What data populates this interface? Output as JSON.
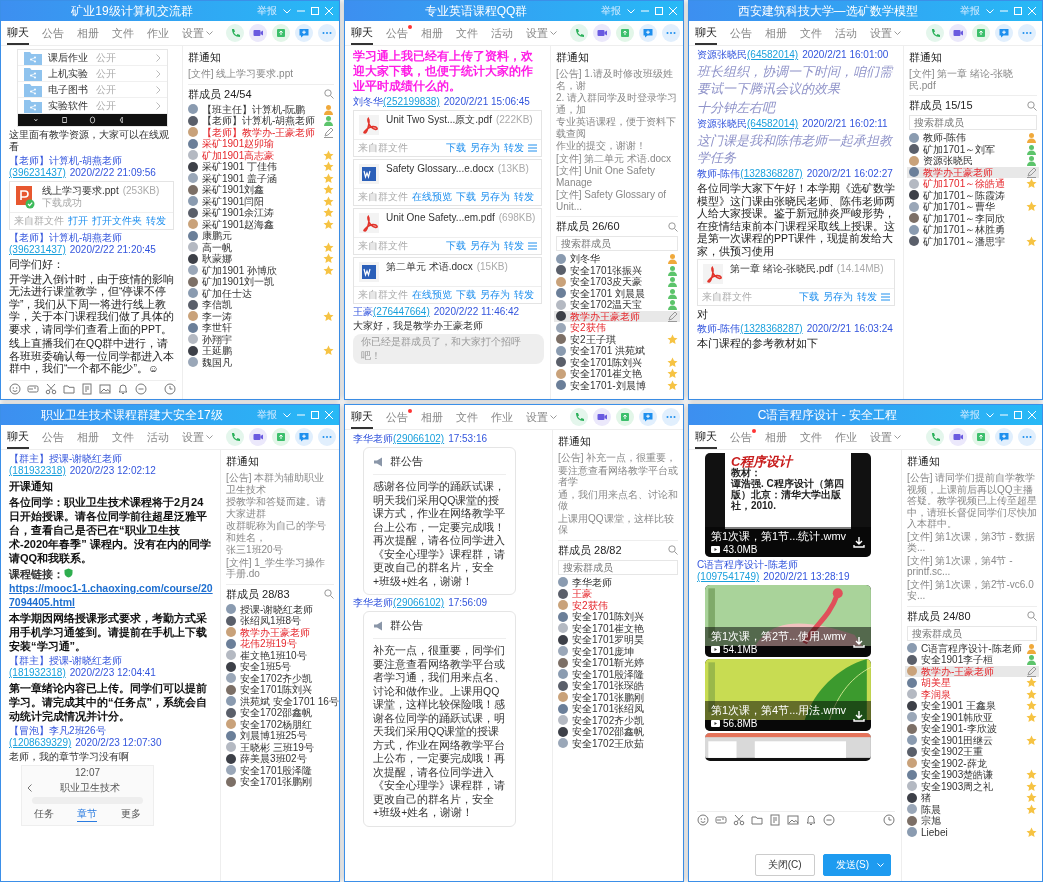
{
  "windows": [
    {
      "title": "矿业19级计算机交流群",
      "report_label": "举报",
      "tabs": [
        {
          "label": "聊天",
          "selected": true,
          "dot": false,
          "menu": false
        },
        {
          "label": "公告",
          "selected": false,
          "dot": false,
          "menu": false
        },
        {
          "label": "相册",
          "selected": false,
          "dot": false,
          "menu": false
        },
        {
          "label": "文件",
          "selected": false,
          "dot": false,
          "menu": false
        },
        {
          "label": "作业",
          "selected": false,
          "dot": false,
          "menu": false
        },
        {
          "label": "设置",
          "selected": false,
          "dot": false,
          "menu": true
        }
      ],
      "messages": [
        {
          "kind": "phone-folders",
          "folders": [
            {
              "name": "课后作业",
              "access": "公开"
            },
            {
              "name": "上机实验",
              "access": "公开"
            },
            {
              "name": "电子图书",
              "access": "公开"
            },
            {
              "name": "实验软件",
              "access": "公开"
            }
          ]
        },
        {
          "kind": "small",
          "text": "这里面有教学资源，大家可以在线观看"
        },
        {
          "kind": "sender",
          "name": "【老师】计算机-胡燕老师",
          "qq": "(396231437)",
          "time": "2020/2/22 21:09:56"
        },
        {
          "kind": "ppt",
          "name": "线上学习要求.ppt",
          "size": "(253KB)",
          "status": "下载成功",
          "source": "来自群文件",
          "actions": [
            "打开",
            "打开文件夹",
            "转发"
          ]
        },
        {
          "kind": "sender",
          "name": "【老师】计算机-胡燕老师",
          "qq": "(396231437)",
          "time": "2020/2/22 21:20:45"
        },
        {
          "kind": "text",
          "text": "同学们好："
        },
        {
          "kind": "text",
          "text": "开学进入倒计时，由于疫情的影响无法进行课堂教学，但“停课不停学”，我们从下周一将进行线上教学，关于本门课程我们做了具体的要求，请同学们查看上面的PPT。"
        },
        {
          "kind": "text",
          "text": "线上直播我们在QQ群中进行，请各班班委确认每一位同学都进入本群中，我们“一个都不能少”。☺"
        }
      ],
      "input_toolbar": true,
      "notice_title": "群通知",
      "notices": [
        "[文件] 线上学习要求.ppt"
      ],
      "members_title": "群成员 24/54",
      "members": [
        {
          "name": "【班主任】计算机-阮鹏",
          "highlighted": false,
          "kind": "owner",
          "selected": false
        },
        {
          "name": "【老师】计算机-胡燕老师",
          "highlighted": false,
          "kind": "manager",
          "selected": false
        },
        {
          "name": "【老师】教学办-王豪老师",
          "highlighted": true,
          "kind": "self",
          "selected": false
        },
        {
          "name": "采矿1901赵卯瑜",
          "highlighted": true,
          "kind": "plain",
          "selected": false
        },
        {
          "name": "矿加1901高志豪",
          "highlighted": true,
          "kind": "star",
          "selected": false
        },
        {
          "name": "采矿1901 丁佳伟",
          "highlighted": false,
          "kind": "star",
          "selected": false
        },
        {
          "name": "采矿1901 盖子涵",
          "highlighted": false,
          "kind": "star",
          "selected": false
        },
        {
          "name": "采矿1901刘鑫",
          "highlighted": false,
          "kind": "star",
          "selected": false
        },
        {
          "name": "采矿1901闫阳",
          "highlighted": false,
          "kind": "star",
          "selected": false
        },
        {
          "name": "采矿1901余江涛",
          "highlighted": false,
          "kind": "star",
          "selected": false
        },
        {
          "name": "采矿1901赵海鑫",
          "highlighted": false,
          "kind": "star",
          "selected": false
        },
        {
          "name": "康鹏元",
          "highlighted": false,
          "kind": "plain",
          "selected": false
        },
        {
          "name": "高一帆",
          "highlighted": false,
          "kind": "star",
          "selected": false
        },
        {
          "name": "耿蒙娜",
          "highlighted": false,
          "kind": "star",
          "selected": false
        },
        {
          "name": "矿加1901 孙博欣",
          "highlighted": false,
          "kind": "star",
          "selected": false
        },
        {
          "name": "矿加1901刘一凯",
          "highlighted": false,
          "kind": "plain",
          "selected": false
        },
        {
          "name": "矿加任士达",
          "highlighted": false,
          "kind": "plain",
          "selected": false
        },
        {
          "name": "李信凯",
          "highlighted": false,
          "kind": "plain",
          "selected": false
        },
        {
          "name": "李一涛",
          "highlighted": false,
          "kind": "star",
          "selected": false
        },
        {
          "name": "李世轩",
          "highlighted": false,
          "kind": "plain",
          "selected": false
        },
        {
          "name": "孙翔宇",
          "highlighted": false,
          "kind": "plain",
          "selected": false
        },
        {
          "name": "王延鹏",
          "highlighted": false,
          "kind": "star",
          "selected": false
        },
        {
          "name": "魏国凡",
          "highlighted": false,
          "kind": "plain",
          "selected": false
        }
      ]
    },
    {
      "title": "专业英语课程QQ群",
      "report_label": "举报",
      "tabs": [
        {
          "label": "聊天",
          "selected": true,
          "dot": false,
          "menu": false
        },
        {
          "label": "公告",
          "selected": false,
          "dot": true,
          "menu": false
        },
        {
          "label": "相册",
          "selected": false,
          "dot": false,
          "menu": false
        },
        {
          "label": "文件",
          "selected": false,
          "dot": false,
          "menu": false
        },
        {
          "label": "活动",
          "selected": false,
          "dot": false,
          "menu": false
        },
        {
          "label": "设置",
          "selected": false,
          "dot": false,
          "menu": true
        }
      ],
      "messages": [
        {
          "kind": "highlight",
          "text": "学习通上我已经有上传了资料，欢迎大家下载，也便于统计大家的作业平时成绩什么的。"
        },
        {
          "kind": "sender",
          "name": "刘冬华",
          "qq": "(252199838)",
          "time": "2020/2/21 15:06:45"
        },
        {
          "kind": "pdf",
          "name": "Unit Two  Syst...原文.pdf",
          "size": "(222KB)",
          "source": "来自群文件",
          "actions": [
            "下载",
            "另存为",
            "转发"
          ]
        },
        {
          "kind": "word",
          "name": "Safety Glossary...e.docx",
          "size": "(13KB)",
          "source": "来自群文件",
          "actions": [
            "在线预览",
            "下载",
            "另存为",
            "转发"
          ]
        },
        {
          "kind": "pdf",
          "name": "Unit One Safety...em.pdf",
          "size": "(698KB)",
          "source": "来自群文件",
          "actions": [
            "下载",
            "另存为",
            "转发"
          ]
        },
        {
          "kind": "word",
          "name": "第二单元 术语.docx",
          "size": "(15KB)",
          "source": "来自群文件",
          "actions": [
            "在线预览",
            "下载",
            "另存为",
            "转发"
          ]
        },
        {
          "kind": "sender",
          "name": "王豪",
          "qq": "(276447664)",
          "time": "2020/2/22 11:46:42"
        },
        {
          "kind": "small",
          "text": "大家好，我是教学办王豪老师"
        },
        {
          "kind": "tip",
          "text": "你已经是群成员了，和大家打个招呼吧！"
        }
      ],
      "notice_title": "群通知",
      "notices": [
        "[公告] 1.请及时修改班级姓名，谢",
        "2. 请入群同学及时登录学习通，加",
        "专业英语课程，便于资料下载查阅",
        "作业的提交，谢谢！",
        "[文件] 第二单元 术语.docx",
        "[文件] Unit One Safety Manage",
        "[文件] Safety Glossary of Unit..."
      ],
      "members_title": "群成员 26/60",
      "search": {
        "placeholder": "搜索群成员"
      },
      "members": [
        {
          "name": "刘冬华",
          "highlighted": false,
          "kind": "owner",
          "selected": false
        },
        {
          "name": "安全1701张振兴",
          "highlighted": false,
          "kind": "manager",
          "selected": false
        },
        {
          "name": "安全1703皮天豪",
          "highlighted": false,
          "kind": "manager",
          "selected": false
        },
        {
          "name": "安全1701 刘晨晨",
          "highlighted": false,
          "kind": "manager",
          "selected": false
        },
        {
          "name": "安全1702温天宝",
          "highlighted": false,
          "kind": "manager",
          "selected": false
        },
        {
          "name": "教学办王豪老师",
          "highlighted": true,
          "kind": "self",
          "selected": true
        },
        {
          "name": "安2获伟",
          "highlighted": true,
          "kind": "plain",
          "selected": false
        },
        {
          "name": "安2王子琪",
          "highlighted": false,
          "kind": "star",
          "selected": false
        },
        {
          "name": "安全1701 洪苑斌",
          "highlighted": false,
          "kind": "plain",
          "selected": false
        },
        {
          "name": "安全1701陈刘兴",
          "highlighted": false,
          "kind": "star",
          "selected": false
        },
        {
          "name": "安全1701崔文艳",
          "highlighted": false,
          "kind": "star",
          "selected": false
        },
        {
          "name": "安全1701-刘晨博",
          "highlighted": false,
          "kind": "star",
          "selected": false
        }
      ]
    },
    {
      "title": "西安建筑科技大学—选矿数学模型",
      "report_label": "举报",
      "tabs": [
        {
          "label": "聊天",
          "selected": true,
          "dot": false,
          "menu": false
        },
        {
          "label": "公告",
          "selected": false,
          "dot": false,
          "menu": false
        },
        {
          "label": "相册",
          "selected": false,
          "dot": false,
          "menu": false
        },
        {
          "label": "文件",
          "selected": false,
          "dot": false,
          "menu": false
        },
        {
          "label": "活动",
          "selected": false,
          "dot": false,
          "menu": false
        },
        {
          "label": "设置",
          "selected": false,
          "dot": false,
          "menu": true
        }
      ],
      "messages": [
        {
          "kind": "sender",
          "name": "资源张晓民",
          "qq": "(64582014)",
          "time": "2020/2/21 16:01:00"
        },
        {
          "kind": "italic",
          "text": "班长组织，协调一下时间，咱们需要试一下腾讯会议的效果"
        },
        {
          "kind": "italic",
          "text": "十分钟左右吧"
        },
        {
          "kind": "sender",
          "name": "资源张晓民",
          "qq": "(64582014)",
          "time": "2020/2/21 16:02:11"
        },
        {
          "kind": "italic",
          "text": "这门课是我和陈伟老师一起承担教学任务"
        },
        {
          "kind": "sender",
          "name": "教师-陈伟",
          "qq": "(1328368287)",
          "time": "2020/2/21 16:02:27"
        },
        {
          "kind": "text",
          "text": "各位同学大家下午好！本学期《选矿数学模型》这门课由张晓民老师、陈伟老师两人给大家授课。鉴于新冠肺炎严峻形势，在疫情结束前本门课程采取线上授课。这是第一次课程的PPT课件，现提前发给大家，供预习使用"
        },
        {
          "kind": "pdf",
          "name": "第一章 绪论-张晓民.pdf",
          "size": "(14.14MB)",
          "source": "来自群文件",
          "actions": [
            "下载",
            "另存为",
            "转发"
          ]
        },
        {
          "kind": "text",
          "text": "对"
        },
        {
          "kind": "sender",
          "name": "教师-陈伟",
          "qq": "(1328368287)",
          "time": "2020/2/21 16:03:24"
        },
        {
          "kind": "text",
          "text": "本门课程的参考教材如下"
        }
      ],
      "notice_title": "群通知",
      "notices": [
        "[文件] 第一章 绪论-张晓民.pdf"
      ],
      "members_title": "群成员 15/15",
      "search": {
        "placeholder": "搜索群成员"
      },
      "members": [
        {
          "name": "教师-陈伟",
          "highlighted": false,
          "kind": "owner",
          "selected": false
        },
        {
          "name": "矿加1701～刘军",
          "highlighted": false,
          "kind": "manager",
          "selected": false
        },
        {
          "name": "资源张晓民",
          "highlighted": false,
          "kind": "manager",
          "selected": false
        },
        {
          "name": "教学办王豪老师",
          "highlighted": true,
          "kind": "self",
          "selected": true
        },
        {
          "name": "矿加1701～徐皓通",
          "highlighted": true,
          "kind": "star",
          "selected": false
        },
        {
          "name": "矿加1701～陈霞涛",
          "highlighted": false,
          "kind": "plain",
          "selected": false
        },
        {
          "name": "矿加1701～曹华",
          "highlighted": false,
          "kind": "star",
          "selected": false
        },
        {
          "name": "矿加1701～李同欣",
          "highlighted": false,
          "kind": "plain",
          "selected": false
        },
        {
          "name": "矿加1701～林胜勇",
          "highlighted": false,
          "kind": "plain",
          "selected": false
        },
        {
          "name": "矿加1701～潘思宇",
          "highlighted": false,
          "kind": "star",
          "selected": false
        }
      ]
    },
    {
      "title": "职业卫生技术课程群建大安全17级",
      "report_label": "举报",
      "tabs": [
        {
          "label": "聊天",
          "selected": true,
          "dot": false,
          "menu": false
        },
        {
          "label": "公告",
          "selected": false,
          "dot": false,
          "menu": false
        },
        {
          "label": "相册",
          "selected": false,
          "dot": false,
          "menu": false
        },
        {
          "label": "文件",
          "selected": false,
          "dot": false,
          "menu": false
        },
        {
          "label": "活动",
          "selected": false,
          "dot": false,
          "menu": false
        },
        {
          "label": "设置",
          "selected": false,
          "dot": false,
          "menu": true
        }
      ],
      "messages": [
        {
          "kind": "sender",
          "name": "【群主】授课-谢晓红老师",
          "qq": "(181932318)",
          "time": "2020/2/23 12:02:12"
        },
        {
          "kind": "bold",
          "text": "开课通知"
        },
        {
          "kind": "bold",
          "text": "各位同学：职业卫生技术课程将于2月24日开始授课。请各位同学前往超星泛雅平台，查看自己是否已在“职业卫生技术-2020年春季” 课程内。没有在内的同学请QQ和我联系。"
        },
        {
          "kind": "link",
          "label": "课程链接：",
          "url": "https://mooc1-1.chaoxing.com/course/207094405.html"
        },
        {
          "kind": "bold",
          "text": "本学期因网络授课形式要求，考勤方式采用手机学习通签到。请提前在手机上下载安装“学习通”。"
        },
        {
          "kind": "sender",
          "name": "【群主】授课-谢晓红老师",
          "qq": "(181932318)",
          "time": "2020/2/23 12:04:41"
        },
        {
          "kind": "bold",
          "text": "第一章绪论内容已上传。同学们可以提前学习。请完成其中的“任务点”，系统会自动统计完成情况并计分。"
        },
        {
          "kind": "sender",
          "name": "【冒泡】李凡2班26号",
          "qq": "(1208639329)",
          "time": "2020/2/23 12:07:30"
        },
        {
          "kind": "small",
          "text": "老师，我的章节学习没有啊"
        },
        {
          "kind": "phone-screenshot",
          "time": "12:07",
          "title": "职业卫生技术",
          "tabs": [
            {
              "label": "任务",
              "selected": false
            },
            {
              "label": "章节",
              "selected": true
            },
            {
              "label": "更多",
              "selected": false
            }
          ]
        }
      ],
      "notice_title": "群通知",
      "notices": [
        "[公告] 本群为辅助职业卫生技术",
        "授教学和答疑而建。请大家进群",
        "改群昵称为自己的学号和姓名，",
        "张三1班20号",
        "[文件] 1_学生学习操作手册.do"
      ],
      "members_title": "群成员 28/83",
      "members": [
        {
          "name": "授课-谢晓红老师",
          "highlighted": false,
          "kind": "plain",
          "selected": false
        },
        {
          "name": "张绍凤1班8号",
          "highlighted": false,
          "kind": "plain",
          "selected": false
        },
        {
          "name": "教学办王豪老师",
          "highlighted": true,
          "kind": "plain",
          "selected": false
        },
        {
          "name": "花伟2班19号",
          "highlighted": true,
          "kind": "plain",
          "selected": false
        },
        {
          "name": "崔文艳1班10号",
          "highlighted": false,
          "kind": "plain",
          "selected": false
        },
        {
          "name": "安全1班5号",
          "highlighted": false,
          "kind": "plain",
          "selected": false
        },
        {
          "name": "安全1702齐少凯",
          "highlighted": false,
          "kind": "plain",
          "selected": false
        },
        {
          "name": "安全1701陈刘兴",
          "highlighted": false,
          "kind": "plain",
          "selected": false
        },
        {
          "name": "洪苑斌 安全1701 16号",
          "highlighted": false,
          "kind": "plain",
          "selected": false
        },
        {
          "name": "安全1702邵鑫帆",
          "highlighted": false,
          "kind": "plain",
          "selected": false
        },
        {
          "name": "安全1702杨朋红",
          "highlighted": false,
          "kind": "plain",
          "selected": false
        },
        {
          "name": "刘晨博1班25号",
          "highlighted": false,
          "kind": "plain",
          "selected": false
        },
        {
          "name": "王晓彬 三班19号",
          "highlighted": false,
          "kind": "plain",
          "selected": false
        },
        {
          "name": "薛美晨3班02号",
          "highlighted": false,
          "kind": "plain",
          "selected": false
        },
        {
          "name": "安全1701殷泽隆",
          "highlighted": false,
          "kind": "plain",
          "selected": false
        },
        {
          "name": "安全1701张鹏刚",
          "highlighted": false,
          "kind": "plain",
          "selected": false
        }
      ]
    },
    {
      "tabs": [
        {
          "label": "聊天",
          "selected": true,
          "dot": false,
          "menu": false
        },
        {
          "label": "公告",
          "selected": false,
          "dot": true,
          "menu": false
        },
        {
          "label": "相册",
          "selected": false,
          "dot": false,
          "menu": false
        },
        {
          "label": "文件",
          "selected": false,
          "dot": false,
          "menu": false
        },
        {
          "label": "作业",
          "selected": false,
          "dot": false,
          "menu": false
        },
        {
          "label": "设置",
          "selected": false,
          "dot": false,
          "menu": true
        }
      ],
      "messages": [
        {
          "kind": "sender",
          "name": "李华老师",
          "qq": "(29066102)",
          "time": "17:53:16"
        },
        {
          "kind": "notice",
          "heading": "群公告",
          "text": "感谢各位同学的踊跃试课，明天我们采用QQ课堂的授课方式，作业在网络教学平台上公布，一定要完成哦！再次提醒，请各位同学进入《安全心理学》课程群，请更改自己的群名片，安全+班级+姓名，谢谢！"
        },
        {
          "kind": "sender",
          "name": "李华老师",
          "qq": "(29066102)",
          "time": "17:56:09"
        },
        {
          "kind": "notice",
          "heading": "群公告",
          "text": "补充一点，很重要，同学们要注意查看网络教学平台或者学习通，我们用来点名、讨论和做作业。上课用QQ课堂，这样比较保险哦！感谢各位同学的踊跃试课，明天我们采用QQ课堂的授课方式，作业在网络教学平台上公布，一定要完成哦！再次提醒，请各位同学进入《安全心理学》课程群，请更改自己的群名片，安全+班级+姓名，谢谢！"
        }
      ],
      "notice_title": "群通知",
      "notices": [
        "[公告] 补充一点，很重要，",
        "要注意查看网络教学平台或者学",
        "通，我们用来点名、讨论和做",
        "上课用QQ课堂，这样比较保"
      ],
      "members_title": "群成员 28/82",
      "search": {
        "placeholder": "搜索群成员"
      },
      "members": [
        {
          "name": "李华老师",
          "highlighted": false,
          "kind": "plain",
          "selected": false
        },
        {
          "name": "王豪",
          "highlighted": true,
          "kind": "plain",
          "selected": false
        },
        {
          "name": "安2获伟",
          "highlighted": true,
          "kind": "plain",
          "selected": false
        },
        {
          "name": "安全1701陈刘兴",
          "highlighted": false,
          "kind": "plain",
          "selected": false
        },
        {
          "name": "安全1701崔文艳",
          "highlighted": false,
          "kind": "plain",
          "selected": false
        },
        {
          "name": "安全1701罗明昊",
          "highlighted": false,
          "kind": "plain",
          "selected": false
        },
        {
          "name": "安全1701庞坤",
          "highlighted": false,
          "kind": "plain",
          "selected": false
        },
        {
          "name": "安全1701靳光婷",
          "highlighted": false,
          "kind": "plain",
          "selected": false
        },
        {
          "name": "安全1701殷泽隆",
          "highlighted": false,
          "kind": "plain",
          "selected": false
        },
        {
          "name": "安全1701张琛皓",
          "highlighted": false,
          "kind": "plain",
          "selected": false
        },
        {
          "name": "安全1701张鹏刚",
          "highlighted": false,
          "kind": "plain",
          "selected": false
        },
        {
          "name": "安全1701张绍凤",
          "highlighted": false,
          "kind": "plain",
          "selected": false
        },
        {
          "name": "安全1702齐少凯",
          "highlighted": false,
          "kind": "plain",
          "selected": false
        },
        {
          "name": "安全1702邵鑫帆",
          "highlighted": false,
          "kind": "plain",
          "selected": false
        },
        {
          "name": "安全1702王欣茹",
          "highlighted": false,
          "kind": "plain",
          "selected": false
        }
      ]
    },
    {
      "title": "C语言程序设计 - 安全工程",
      "report_label": "举报",
      "tabs": [
        {
          "label": "聊天",
          "selected": true,
          "dot": false,
          "menu": false
        },
        {
          "label": "公告",
          "selected": false,
          "dot": true,
          "menu": false
        },
        {
          "label": "相册",
          "selected": false,
          "dot": false,
          "menu": false
        },
        {
          "label": "文件",
          "selected": false,
          "dot": false,
          "menu": false
        },
        {
          "label": "作业",
          "selected": false,
          "dot": false,
          "menu": false
        },
        {
          "label": "设置",
          "selected": false,
          "dot": false,
          "menu": true
        }
      ],
      "messages": [
        {
          "kind": "slide-video",
          "slide_title": "C程序设计",
          "slide_lines": [
            "教材：",
            "谭浩强. C程序设计（第四版）北京：清华大学出版社，2010."
          ],
          "name": "第1次课，第1节...统计.wmv",
          "size": "43.0MB"
        },
        {
          "kind": "sender",
          "name": "C语言程序设计-陈老师",
          "qq": "(1097541749)",
          "time": "2020/2/21 13:28:19"
        },
        {
          "kind": "flower-video",
          "name": "第1次课，第2节...使用.wmv",
          "size": "54.1MB"
        },
        {
          "kind": "leaf-video",
          "name": "第1次课，第4节...用法.wmv",
          "size": "56.8MB"
        },
        {
          "kind": "editor-video"
        }
      ],
      "input_toolbar": true,
      "buttons": [
        {
          "label": "关闭(C)",
          "kind": "secondary"
        },
        {
          "label": "发送(S)",
          "kind": "primary"
        }
      ],
      "notice_title": "群通知",
      "notices": [
        "[公告] 请同学们提前自学教学视频，上课前后再以QQ主播答疑。教学视频已上传至超星中，请班长督促同学们尽快加入本群中。",
        "[文件] 第1次课，第3节 - 数据类...",
        "[文件] 第1次课，第4节 - printf.sc...",
        "[文件] 第1次课，第2节-vc6.0安..."
      ],
      "members_title": "群成员 24/80",
      "search": {
        "placeholder": "搜索群成员"
      },
      "members": [
        {
          "name": "C语言程序设计-陈老师",
          "highlighted": false,
          "kind": "owner",
          "selected": false
        },
        {
          "name": "安全1901李子桓",
          "highlighted": false,
          "kind": "manager",
          "selected": false
        },
        {
          "name": "教学办-王豪老师",
          "highlighted": true,
          "kind": "self",
          "selected": true
        },
        {
          "name": "胡美星",
          "highlighted": true,
          "kind": "star",
          "selected": false
        },
        {
          "name": "李润泉",
          "highlighted": true,
          "kind": "star",
          "selected": false
        },
        {
          "name": "安全1901 王鑫泉",
          "highlighted": false,
          "kind": "star",
          "selected": false
        },
        {
          "name": "安全1901韩欣亚",
          "highlighted": false,
          "kind": "star",
          "selected": false
        },
        {
          "name": "安全1901-李欣波",
          "highlighted": false,
          "kind": "plain",
          "selected": false
        },
        {
          "name": "安全1901田继云",
          "highlighted": false,
          "kind": "star",
          "selected": false
        },
        {
          "name": "安全1902王重",
          "highlighted": false,
          "kind": "plain",
          "selected": false
        },
        {
          "name": "安全1902-薛龙",
          "highlighted": false,
          "kind": "plain",
          "selected": false
        },
        {
          "name": "安全1903楚皓谦",
          "highlighted": false,
          "kind": "star",
          "selected": false
        },
        {
          "name": "安全1903周之礼",
          "highlighted": false,
          "kind": "star",
          "selected": false
        },
        {
          "name": "猪",
          "highlighted": false,
          "kind": "star",
          "selected": false
        },
        {
          "name": "陈晨",
          "highlighted": false,
          "kind": "star",
          "selected": false
        },
        {
          "name": "宗旭",
          "highlighted": false,
          "kind": "plain",
          "selected": false
        },
        {
          "name": "Liebei",
          "highlighted": false,
          "kind": "star",
          "selected": false
        }
      ]
    }
  ]
}
